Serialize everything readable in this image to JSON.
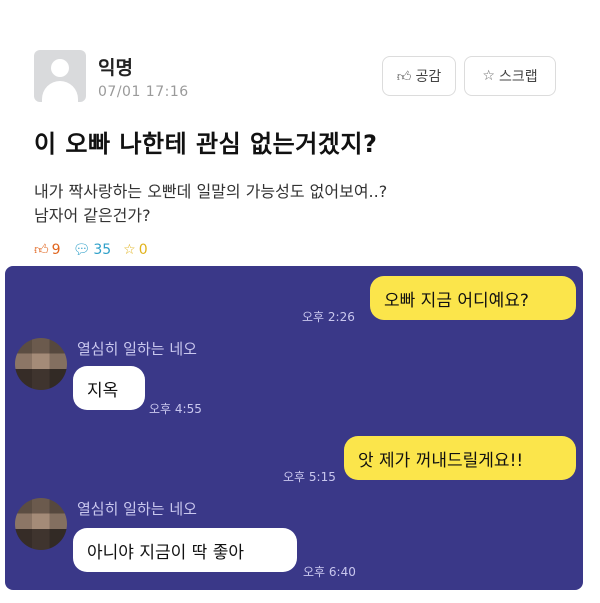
{
  "post": {
    "author": "익명",
    "date": "07/01 17:16",
    "like_label": "공감",
    "scrap_label": "스크랩",
    "title": "이 오빠 나한테 관심 없는거겠지?",
    "body_line1": "내가 짝사랑하는 오빤데 일말의 가능성도 없어보여..?",
    "body_line2": "남자어 같은건가?",
    "stats": {
      "likes": "9",
      "comments": "35",
      "scraps": "0"
    },
    "icons": {
      "like": "thumbs-up-icon",
      "comment": "speech-bubble-icon",
      "scrap": "star-icon"
    }
  },
  "chat": {
    "background": "#3a3888",
    "my_bubble_color": "#fbe54b",
    "messages": [
      {
        "sender": "",
        "text": "오빠 지금 어디예요?",
        "time": "오후 2:26"
      },
      {
        "sender": "열심히 일하는 네오",
        "text": "지옥",
        "time": "오후 4:55"
      },
      {
        "sender": "",
        "text": "앗 제가 꺼내드릴게요!!",
        "time": "오후 5:15"
      },
      {
        "sender": "열심히 일하는 네오",
        "text": "아니야 지금이 딱 좋아",
        "time": "오후 6:40"
      }
    ]
  }
}
